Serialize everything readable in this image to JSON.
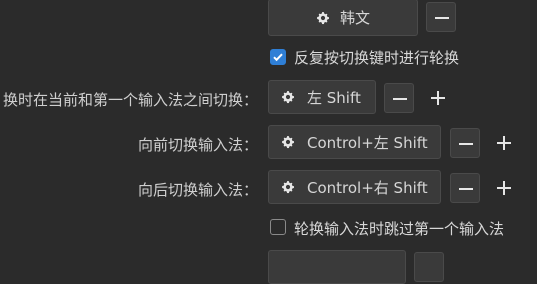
{
  "lang_row": {
    "button_label": "韩文",
    "remove_icon": "minus-icon"
  },
  "cycle_checkbox": {
    "label": "反复按切换键时进行轮换",
    "checked": true
  },
  "toggle_row": {
    "label": "换时在当前和第一个输入法之间切换：",
    "button_label": "左 Shift"
  },
  "forward_row": {
    "label": "向前切换输入法：",
    "button_label": "Control+左 Shift"
  },
  "backward_row": {
    "label": "向后切换输入法：",
    "button_label": "Control+右 Shift"
  },
  "skip_checkbox": {
    "label": "轮换输入法时跳过第一个输入法",
    "checked": false
  },
  "colors": {
    "background": "#2b2b2b",
    "accent": "#2f7fd6",
    "button": "#3a3a3a"
  }
}
